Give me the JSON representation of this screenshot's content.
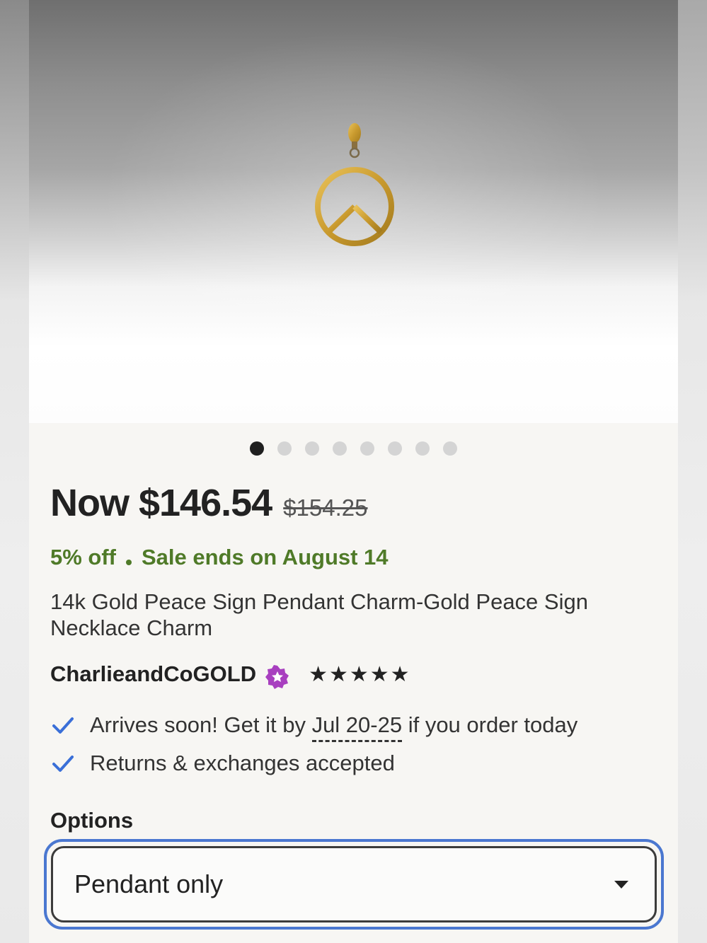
{
  "gallery": {
    "image_description": "",
    "dots_count": 8,
    "active_index": 0
  },
  "price": {
    "now": "Now $146.54",
    "original": "$154.25"
  },
  "sale": {
    "discount": "5% off",
    "ends": "Sale ends on August 14",
    "color": "#4f7a28"
  },
  "listing": {
    "title": "14k Gold Peace Sign Pendant Charm-Gold Peace Sign Necklace Charm"
  },
  "shop": {
    "name": "CharlieandCoGOLD",
    "badge_icon": "star-seller-badge-icon",
    "rating_stars": "★★★★★",
    "rating": 5
  },
  "perks": {
    "arrives_prefix": "Arrives soon! Get it by ",
    "arrives_dates": "Jul 20-25",
    "arrives_suffix": " if you order today",
    "returns": "Returns & exchanges accepted",
    "check_color": "#3a6fd8"
  },
  "options": {
    "label": "Options",
    "selected": "Pendant only",
    "focus_color": "#4a77d0"
  }
}
